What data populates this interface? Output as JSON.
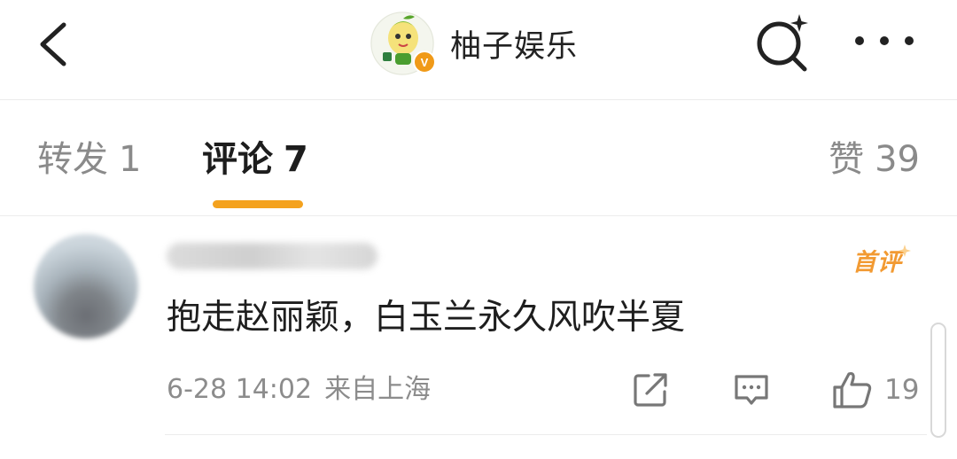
{
  "header": {
    "account_name": "柚子娱乐",
    "verified_badge": "V",
    "icons": {
      "back": "back-chevron-icon",
      "search": "search-sparkle-icon",
      "more": "more-dots-icon"
    }
  },
  "tabs": [
    {
      "label": "转发",
      "count": "1",
      "active": false
    },
    {
      "label": "评论",
      "count": "7",
      "active": true
    },
    {
      "label": "赞",
      "count": "39",
      "active": false
    }
  ],
  "comment": {
    "badge": "首评",
    "text": "抱走赵丽颖，白玉兰永久风吹半夏",
    "time": "6-28 14:02",
    "location": "来自上海",
    "likes": "19",
    "icons": {
      "share": "share-icon",
      "reply": "comment-icon",
      "like": "thumbs-up-icon"
    }
  },
  "colors": {
    "accent": "#f4a21e",
    "badge": "#f29a32",
    "muted": "#8c8c8c"
  }
}
